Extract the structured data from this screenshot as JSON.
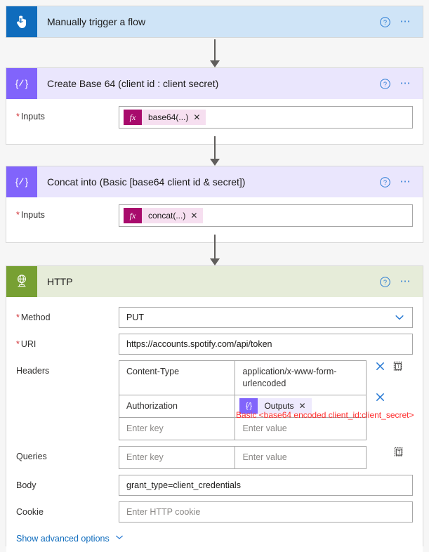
{
  "flow": {
    "steps": [
      {
        "id": "trigger",
        "title": "Manually trigger a flow",
        "icon": "hand-tap-icon",
        "help_icon": "help-circle-icon",
        "menu_icon": "ellipsis-icon"
      },
      {
        "id": "compose_base64",
        "title": "Create Base 64 (client id : client secret)",
        "icon": "compose-braces-icon",
        "help_icon": "help-circle-icon",
        "menu_icon": "ellipsis-icon",
        "inputs_label": "Inputs",
        "inputs_required": "*",
        "token": {
          "badge": "fx",
          "text": "base64(...)",
          "close": "✕"
        }
      },
      {
        "id": "compose_concat",
        "title": "Concat into (Basic [base64 client id & secret])",
        "icon": "compose-braces-icon",
        "help_icon": "help-circle-icon",
        "menu_icon": "ellipsis-icon",
        "inputs_label": "Inputs",
        "inputs_required": "*",
        "token": {
          "badge": "fx",
          "text": "concat(...)",
          "close": "✕"
        }
      },
      {
        "id": "http",
        "title": "HTTP",
        "icon": "globe-network-icon",
        "help_icon": "help-circle-icon",
        "menu_icon": "ellipsis-icon"
      }
    ]
  },
  "http": {
    "method": {
      "label": "Method",
      "required": "*",
      "value": "PUT",
      "chevron_icon": "chevron-down-icon"
    },
    "uri": {
      "label": "URI",
      "required": "*",
      "value": "https://accounts.spotify.com/api/token"
    },
    "headers": {
      "label": "Headers",
      "key_placeholder": "Enter key",
      "value_placeholder": "Enter value",
      "rows": [
        {
          "key": "Content-Type",
          "value": "application/x-www-form-urlencoded",
          "type": "text"
        },
        {
          "key": "Authorization",
          "token": {
            "badge": "{∕}",
            "text": "Outputs",
            "close": "✕"
          },
          "type": "token"
        },
        {
          "key": "",
          "value": "",
          "type": "empty"
        }
      ],
      "delete_icon": "close-x-icon",
      "switch_text_mode_icon": "text-mode-clipboard-icon"
    },
    "queries": {
      "label": "Queries",
      "key_placeholder": "Enter key",
      "value_placeholder": "Enter value",
      "switch_text_mode_icon": "text-mode-clipboard-icon"
    },
    "body": {
      "label": "Body",
      "value": "grant_type=client_credentials"
    },
    "cookie": {
      "label": "Cookie",
      "placeholder": "Enter HTTP cookie"
    },
    "advanced": {
      "label": "Show advanced options",
      "chevron_icon": "chevron-down-icon"
    }
  },
  "annotation": {
    "text": "Basic <base64 encoded client_id:client_secret>",
    "color": "#ff2d2d"
  },
  "colors": {
    "trigger_header": "#cfe4f7",
    "trigger_icon": "#0f6cbd",
    "compose_header": "#eae6fd",
    "compose_icon": "#8164fb",
    "http_header": "#e6ecd9",
    "http_icon": "#77a033",
    "link": "#0f6cbd",
    "required": "#d13438"
  }
}
